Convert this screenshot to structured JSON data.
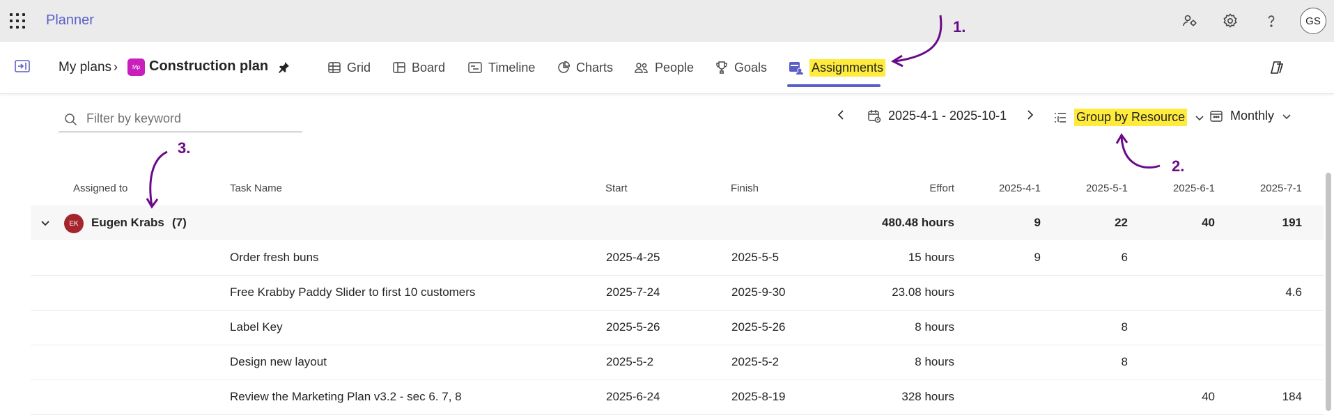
{
  "app": {
    "name": "Planner"
  },
  "header": {
    "avatar_initials": "GS",
    "icons": [
      "people-settings-icon",
      "gear-icon",
      "help-icon"
    ]
  },
  "breadcrumb": {
    "root": "My plans",
    "badge": "Mp",
    "plan_title": "Construction plan"
  },
  "tabs": [
    {
      "label": "Grid",
      "icon": "grid-icon"
    },
    {
      "label": "Board",
      "icon": "board-icon"
    },
    {
      "label": "Timeline",
      "icon": "timeline-icon"
    },
    {
      "label": "Charts",
      "icon": "charts-icon"
    },
    {
      "label": "People",
      "icon": "people-icon"
    },
    {
      "label": "Goals",
      "icon": "trophy-icon"
    },
    {
      "label": "Assignments",
      "icon": "assignments-icon",
      "active": true
    }
  ],
  "toolbar": {
    "filter_placeholder": "Filter by keyword",
    "date_range": "2025-4-1 - 2025-10-1",
    "group_by": "Group by Resource",
    "period": "Monthly"
  },
  "columns": {
    "assigned_to": "Assigned to",
    "task_name": "Task Name",
    "start": "Start",
    "finish": "Finish",
    "effort": "Effort",
    "m1": "2025-4-1",
    "m2": "2025-5-1",
    "m3": "2025-6-1",
    "m4": "2025-7-1"
  },
  "group": {
    "initials": "EK",
    "name": "Eugen Krabs",
    "count": "(7)",
    "effort": "480.48 hours",
    "m1": "9",
    "m2": "22",
    "m3": "40",
    "m4": "191"
  },
  "rows": [
    {
      "task": "Order fresh buns",
      "start": "2025-4-25",
      "finish": "2025-5-5",
      "effort": "15 hours",
      "m1": "9",
      "m2": "6",
      "m3": "",
      "m4": ""
    },
    {
      "task": "Free Krabby Paddy Slider to first 10 customers",
      "start": "2025-7-24",
      "finish": "2025-9-30",
      "effort": "23.08 hours",
      "m1": "",
      "m2": "",
      "m3": "",
      "m4": "4.6"
    },
    {
      "task": "Label Key",
      "start": "2025-5-26",
      "finish": "2025-5-26",
      "effort": "8 hours",
      "m1": "",
      "m2": "8",
      "m3": "",
      "m4": ""
    },
    {
      "task": "Design new layout",
      "start": "2025-5-2",
      "finish": "2025-5-2",
      "effort": "8 hours",
      "m1": "",
      "m2": "8",
      "m3": "",
      "m4": ""
    },
    {
      "task": "Review the Marketing Plan v3.2 - sec 6. 7, 8",
      "start": "2025-6-24",
      "finish": "2025-8-19",
      "effort": "328 hours",
      "m1": "",
      "m2": "",
      "m3": "40",
      "m4": "184"
    }
  ],
  "annotations": {
    "a1": "1.",
    "a2": "2.",
    "a3": "3.",
    "color": "#6a0a8a"
  }
}
